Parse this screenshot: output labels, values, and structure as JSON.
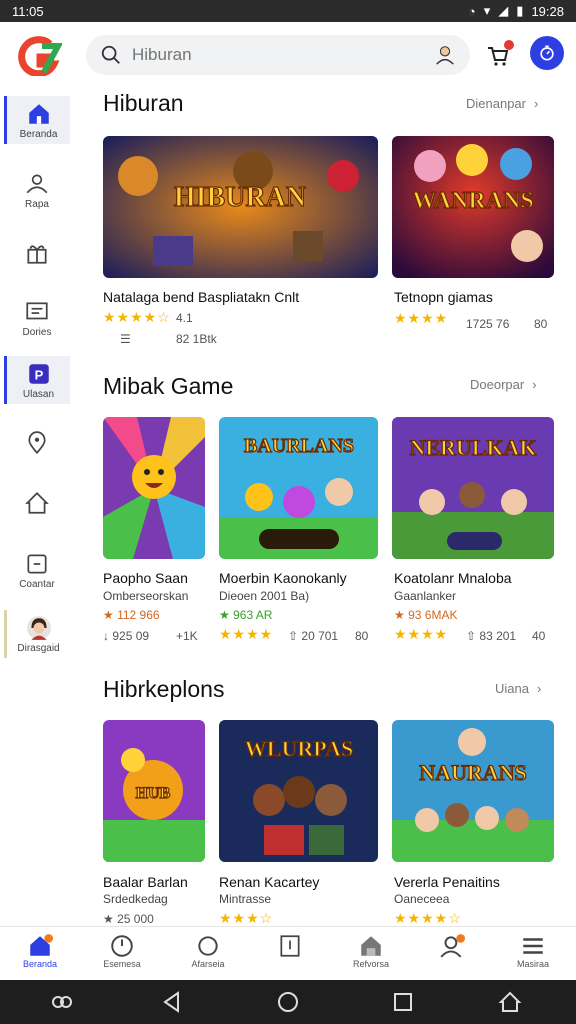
{
  "status": {
    "time": "11:05",
    "clock": "19:28"
  },
  "search": {
    "placeholder": "Hiburan"
  },
  "sidebar": {
    "items": [
      {
        "label": "Beranda",
        "icon": "home-icon"
      },
      {
        "label": "Rapa",
        "icon": "people-icon"
      },
      {
        "label": "",
        "icon": "gift-icon"
      },
      {
        "label": "Dories",
        "icon": "message-icon"
      },
      {
        "label": "Ulasan",
        "icon": "app-icon"
      },
      {
        "label": "",
        "icon": "location-icon"
      },
      {
        "label": "",
        "icon": "house-icon"
      },
      {
        "label": "Coantar",
        "icon": "card-icon"
      },
      {
        "label": "Dirasgaid",
        "icon": "profile-avatar"
      }
    ]
  },
  "sections": [
    {
      "title": "Hiburan",
      "more": "Dienanpar",
      "cards": [
        {
          "title": "Natalaga bend Baspliatakn Cnlt",
          "art": "HIBURAN",
          "rating": "4.1",
          "count": "82 1Btk"
        },
        {
          "title": "Tetnopn giamas",
          "art": "WANRANS",
          "rating": "",
          "count": "1725 76",
          "extra": "80"
        }
      ]
    },
    {
      "title": "Mibak Game",
      "more": "Doeorpar",
      "cards": [
        {
          "title": "Paopho Saan",
          "sub": "Omberseorskan",
          "price": "112 966",
          "art": "",
          "count": "925 09",
          "extra": "+1K"
        },
        {
          "title": "Moerbin Kaonokanly",
          "sub": "Dieoen 2001 Ba)",
          "price": "963 AR",
          "art": "BAURLANS",
          "count": "20 701",
          "extra": "80"
        },
        {
          "title": "Koatolanr Mnaloba",
          "sub": "Gaanlanker",
          "price": "93 6MAK",
          "art": "NERULKAK",
          "count": "83 201",
          "extra": "40"
        }
      ]
    },
    {
      "title": "Hibrkeplons",
      "more": "Uiana",
      "cards": [
        {
          "title": "Baalar Barlan",
          "sub": "Srdedkedag",
          "count": "25 000",
          "art": "HUB"
        },
        {
          "title": "Renan Kacartey",
          "sub": "Mintrasse",
          "art": "WLURPAS"
        },
        {
          "title": "Vererla Penaitins",
          "sub": "Oaneceea",
          "art": "NAURANS"
        }
      ]
    }
  ],
  "bottomnav": {
    "items": [
      {
        "label": "Beranda"
      },
      {
        "label": "Esemesa"
      },
      {
        "label": "Afarseia"
      },
      {
        "label": ""
      },
      {
        "label": "Refvorsa"
      },
      {
        "label": ""
      },
      {
        "label": "Masiraa"
      }
    ]
  }
}
